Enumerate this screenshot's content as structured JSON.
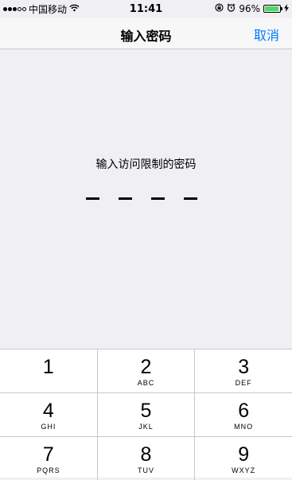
{
  "status_bar": {
    "carrier": "中国移动",
    "time": "11:41",
    "battery_percent": "96%",
    "battery_level": 0.96,
    "icons": [
      "signal-dots-icon",
      "wifi-icon",
      "rotation-lock-icon",
      "alarm-icon",
      "battery-icon",
      "charging-bolt-icon"
    ],
    "signal_glyph": "●●●○○",
    "wifi_glyph": "≋",
    "rotation_lock_glyph": "⊕",
    "alarm_glyph": "⏰",
    "bolt_glyph": "ϟ"
  },
  "nav": {
    "title": "输入密码",
    "cancel_label": "取消"
  },
  "passcode": {
    "prompt": "输入访问限制的密码",
    "digits_entered": 0,
    "digits_total": 4
  },
  "keypad": {
    "rows": [
      [
        {
          "digit": "1",
          "letters": ""
        },
        {
          "digit": "2",
          "letters": "ABC"
        },
        {
          "digit": "3",
          "letters": "DEF"
        }
      ],
      [
        {
          "digit": "4",
          "letters": "GHI"
        },
        {
          "digit": "5",
          "letters": "JKL"
        },
        {
          "digit": "6",
          "letters": "MNO"
        }
      ],
      [
        {
          "digit": "7",
          "letters": "PQRS"
        },
        {
          "digit": "8",
          "letters": "TUV"
        },
        {
          "digit": "9",
          "letters": "WXYZ"
        }
      ]
    ]
  },
  "colors": {
    "accent": "#007aff",
    "background": "#efeff4",
    "battery": "#4cd964"
  }
}
